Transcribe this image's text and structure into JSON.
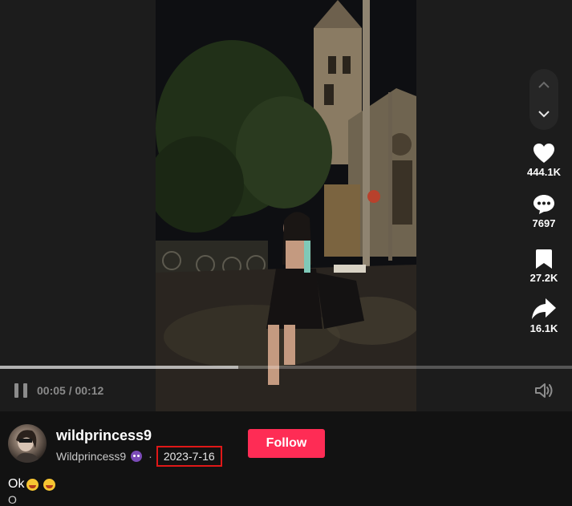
{
  "player": {
    "time_display": "00:05 / 00:12",
    "progress_fraction": 0.4167
  },
  "actions": {
    "likes": "444.1K",
    "comments": "7697",
    "saves": "27.2K",
    "shares": "16.1K"
  },
  "author": {
    "username": "wildprincess9",
    "nickname": "Wildprincess9",
    "separator": "·",
    "post_date": "2023-7-16"
  },
  "follow_label": "Follow",
  "caption": {
    "text": "Ok",
    "partial_line": "O"
  },
  "colors": {
    "accent": "#fe2c55",
    "highlight_box": "#e01818",
    "background": "#121212"
  },
  "icons": [
    "chevron-up-icon",
    "chevron-down-icon",
    "heart-icon",
    "comment-icon",
    "bookmark-icon",
    "share-icon",
    "pause-icon",
    "volume-icon"
  ]
}
